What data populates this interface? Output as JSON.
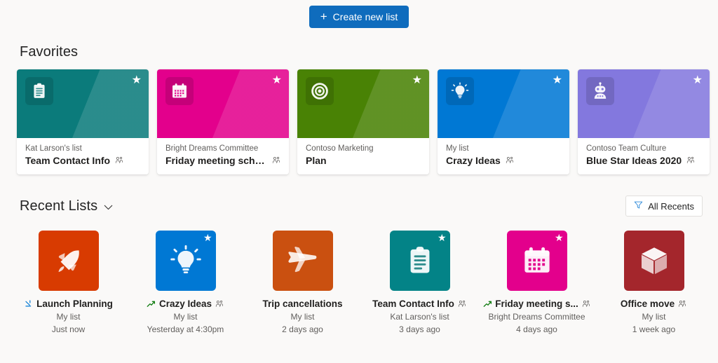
{
  "toolbar": {
    "create_label": "Create new list",
    "create_icon": "plus-icon",
    "create_bg": "#0f6cbd"
  },
  "favorites": {
    "title": "Favorites",
    "cards": [
      {
        "owner": "Kat Larson's list",
        "name": "Team Contact Info",
        "color": "#0b7b7b",
        "icon": "clipboard-icon",
        "starred": true,
        "shared": true
      },
      {
        "owner": "Bright Dreams Committee",
        "name": "Friday meeting schedule",
        "color": "#e3008c",
        "icon": "calendar-icon",
        "starred": true,
        "shared": true
      },
      {
        "owner": "Contoso Marketing",
        "name": "Plan",
        "color": "#498205",
        "icon": "target-icon",
        "starred": true,
        "shared": false
      },
      {
        "owner": "My list",
        "name": "Crazy Ideas",
        "color": "#0078d4",
        "icon": "lightbulb-icon",
        "starred": true,
        "shared": true
      },
      {
        "owner": "Contoso Team Culture",
        "name": "Blue Star Ideas 2020",
        "color": "#8378de",
        "icon": "robot-icon",
        "starred": true,
        "shared": true
      }
    ]
  },
  "recent": {
    "title": "Recent Lists",
    "chevron_icon": "chevron-down-icon",
    "filter": {
      "label": "All Recents",
      "icon": "filter-icon",
      "icon_color": "#2b88d8"
    },
    "tiles": [
      {
        "name": "Launch Planning",
        "owner": "My list",
        "time": "Just now",
        "color": "#d83b01",
        "icon": "rocket-icon",
        "starred": false,
        "shared": false,
        "badge": "new-activity-icon"
      },
      {
        "name": "Crazy Ideas",
        "owner": "My list",
        "time": "Yesterday at 4:30pm",
        "color": "#0078d4",
        "icon": "lightbulb-icon",
        "starred": true,
        "shared": true,
        "badge": "trending-icon"
      },
      {
        "name": "Trip cancellations",
        "owner": "My list",
        "time": "2 days ago",
        "color": "#ca5010",
        "icon": "airplane-icon",
        "starred": false,
        "shared": false,
        "badge": ""
      },
      {
        "name": "Team Contact Info",
        "owner": "Kat Larson's list",
        "time": "3 days ago",
        "color": "#038387",
        "icon": "clipboard-icon",
        "starred": true,
        "shared": true,
        "badge": ""
      },
      {
        "name": "Friday meeting s...",
        "owner": "Bright Dreams Committee",
        "time": "4 days ago",
        "color": "#e3008c",
        "icon": "calendar-icon",
        "starred": true,
        "shared": true,
        "badge": "trending-icon"
      },
      {
        "name": "Office move",
        "owner": "My list",
        "time": "1 week ago",
        "color": "#a4262c",
        "icon": "cube-icon",
        "starred": false,
        "shared": true,
        "badge": ""
      }
    ]
  }
}
